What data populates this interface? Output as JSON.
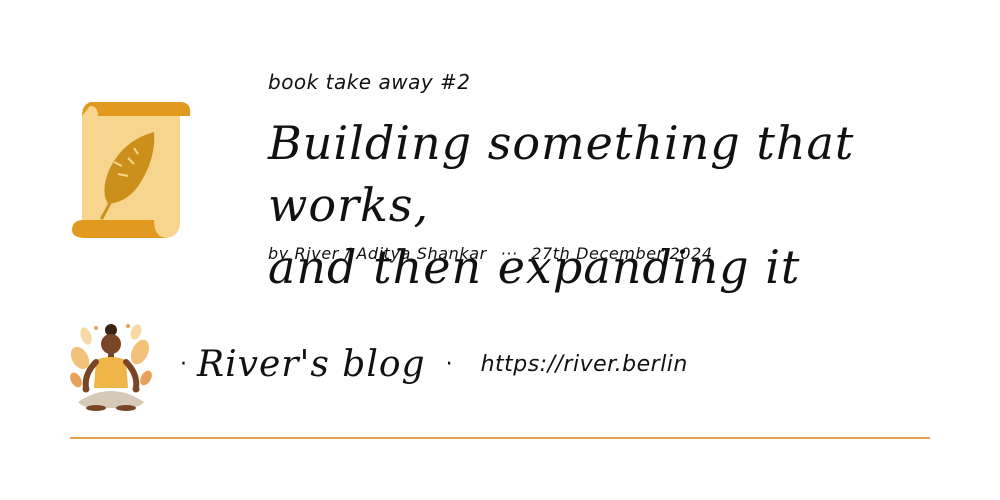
{
  "header": {
    "eyebrow": "book take away #2",
    "title_line1": "Building something that works,",
    "title_line2": "and then expanding it",
    "byline": {
      "by": "by River / Aditya Shankar",
      "separator": "···",
      "date": "27th December 2024"
    }
  },
  "footer": {
    "bullet": "·",
    "blog_name": "River's blog",
    "blog_url": "https://river.berlin"
  },
  "colors": {
    "accent_orange": "#E19A1F",
    "scroll_paper": "#F7D58E",
    "feather": "#CB901B",
    "divider": "#E3A24A"
  },
  "icons": [
    "scroll-feather-icon",
    "meditating-person-avatar"
  ]
}
